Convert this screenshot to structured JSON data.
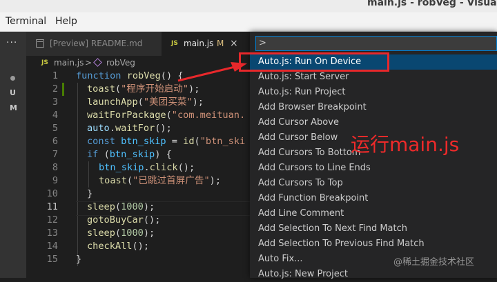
{
  "window": {
    "title": "main.js - robVeg - Visual St"
  },
  "menubar": {
    "items": [
      "Terminal",
      "Help"
    ]
  },
  "activity_bar": {
    "more_label": "···",
    "scm_letters": [
      "U",
      "M"
    ]
  },
  "tabs": [
    {
      "label": "[Preview] README.md",
      "active": false
    },
    {
      "label": "main.js",
      "badge": "JS",
      "status": "M",
      "close": "×",
      "active": true
    }
  ],
  "breadcrumb": {
    "file": "main.js",
    "separator": ">",
    "symbol": "robVeg",
    "badge": "JS"
  },
  "editor": {
    "line_numbers": [
      "1",
      "2",
      "3",
      "4",
      "5",
      "6",
      "7",
      "8",
      "9",
      "10",
      "11",
      "12",
      "13",
      "14",
      "15"
    ],
    "current_line": "11",
    "lines": [
      [
        [
          "kw",
          "function "
        ],
        [
          "fn",
          "robVeg"
        ],
        [
          "p",
          "() {"
        ]
      ],
      [
        [
          "fn",
          "toast"
        ],
        [
          "p",
          "("
        ],
        [
          "str",
          "\"程序开始启动\""
        ],
        [
          "p",
          ");"
        ]
      ],
      [
        [
          "fn",
          "launchApp"
        ],
        [
          "p",
          "("
        ],
        [
          "str",
          "\"美团买菜\""
        ],
        [
          "p",
          ");"
        ]
      ],
      [
        [
          "fn",
          "waitForPackage"
        ],
        [
          "p",
          "("
        ],
        [
          "str",
          "\"com.meituan."
        ]
      ],
      [
        [
          "vr",
          "auto"
        ],
        [
          "p",
          "."
        ],
        [
          "fn",
          "waitFor"
        ],
        [
          "p",
          "();"
        ]
      ],
      [
        [
          "kw",
          "const "
        ],
        [
          "var",
          "btn_skip"
        ],
        [
          "p",
          " = "
        ],
        [
          "fn",
          "id"
        ],
        [
          "p",
          "("
        ],
        [
          "str",
          "\"btn_ski"
        ]
      ],
      [
        [
          "kw",
          "if "
        ],
        [
          "p",
          "("
        ],
        [
          "var",
          "btn_skip"
        ],
        [
          "p",
          ") {"
        ]
      ],
      [
        [
          "var",
          "btn_skip"
        ],
        [
          "p",
          "."
        ],
        [
          "fn",
          "click"
        ],
        [
          "p",
          "();"
        ]
      ],
      [
        [
          "fn",
          "toast"
        ],
        [
          "p",
          "("
        ],
        [
          "str",
          "\"已跳过首屏广告\""
        ],
        [
          "p",
          ");"
        ]
      ],
      [
        [
          "p",
          "}"
        ]
      ],
      [
        [
          "fn",
          "sleep"
        ],
        [
          "p",
          "("
        ],
        [
          "num",
          "1000"
        ],
        [
          "p",
          ");"
        ]
      ],
      [
        [
          "fn",
          "gotoBuyCar"
        ],
        [
          "p",
          "();"
        ]
      ],
      [
        [
          "fn",
          "sleep"
        ],
        [
          "p",
          "("
        ],
        [
          "num",
          "1000"
        ],
        [
          "p",
          ");"
        ]
      ],
      [
        [
          "fn",
          "checkAll"
        ],
        [
          "p",
          "();"
        ]
      ],
      [
        [
          "p",
          "}"
        ]
      ]
    ]
  },
  "command_palette": {
    "input_value": ">",
    "items": [
      "Auto.js: Run On Device",
      "Auto.js: Start Server",
      "Auto.js: Run Project",
      "Add Browser Breakpoint",
      "Add Cursor Above",
      "Add Cursor Below",
      "Add Cursors To Bottom",
      "Add Cursors to Line Ends",
      "Add Cursors To Top",
      "Add Function Breakpoint",
      "Add Line Comment",
      "Add Selection To Next Find Match",
      "Add Selection To Previous Find Match",
      "Auto Fix...",
      "Auto.js: New Project"
    ],
    "selected_index": 0
  },
  "annotation": {
    "text": "运行main.js",
    "color": "#ee2a2a"
  },
  "watermark": {
    "text": "@稀土掘金技术社区"
  },
  "colors": {
    "accent": "#007fd4",
    "selection": "#094771",
    "highlight": "#e8282b"
  }
}
